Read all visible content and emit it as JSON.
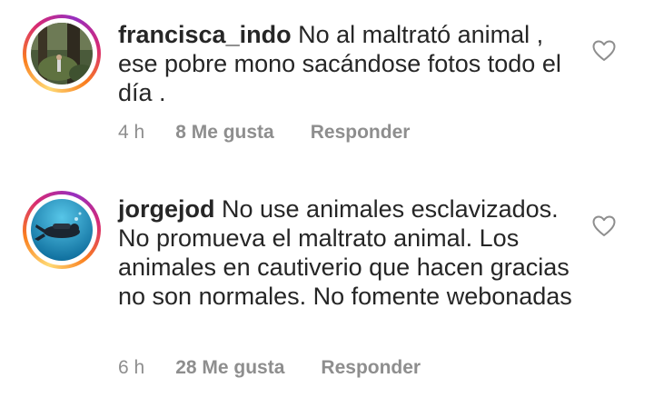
{
  "comments": [
    {
      "username": "francisca_indo",
      "text": " No al maltrató animal , ese pobre mono sacándose fotos todo el día .",
      "time": "4 h",
      "likes": "8 Me gusta",
      "reply": "Responder",
      "avatar_icon": "forest-photo-avatar",
      "like_icon": "heart-outline-icon"
    },
    {
      "username": "jorgejod",
      "text": " No use animales esclavizados. No promueva el maltrato animal. Los animales en cautiverio que hacen gracias no son normales. No fomente webonadas",
      "time": "6 h",
      "likes": "28 Me gusta",
      "reply": "Responder",
      "avatar_icon": "diver-underwater-avatar",
      "like_icon": "heart-outline-icon"
    }
  ],
  "colors": {
    "text": "#262626",
    "meta": "#8e8e8e",
    "story_ring": [
      "#feda75",
      "#fa7e1e",
      "#d62976",
      "#962fbf"
    ]
  }
}
